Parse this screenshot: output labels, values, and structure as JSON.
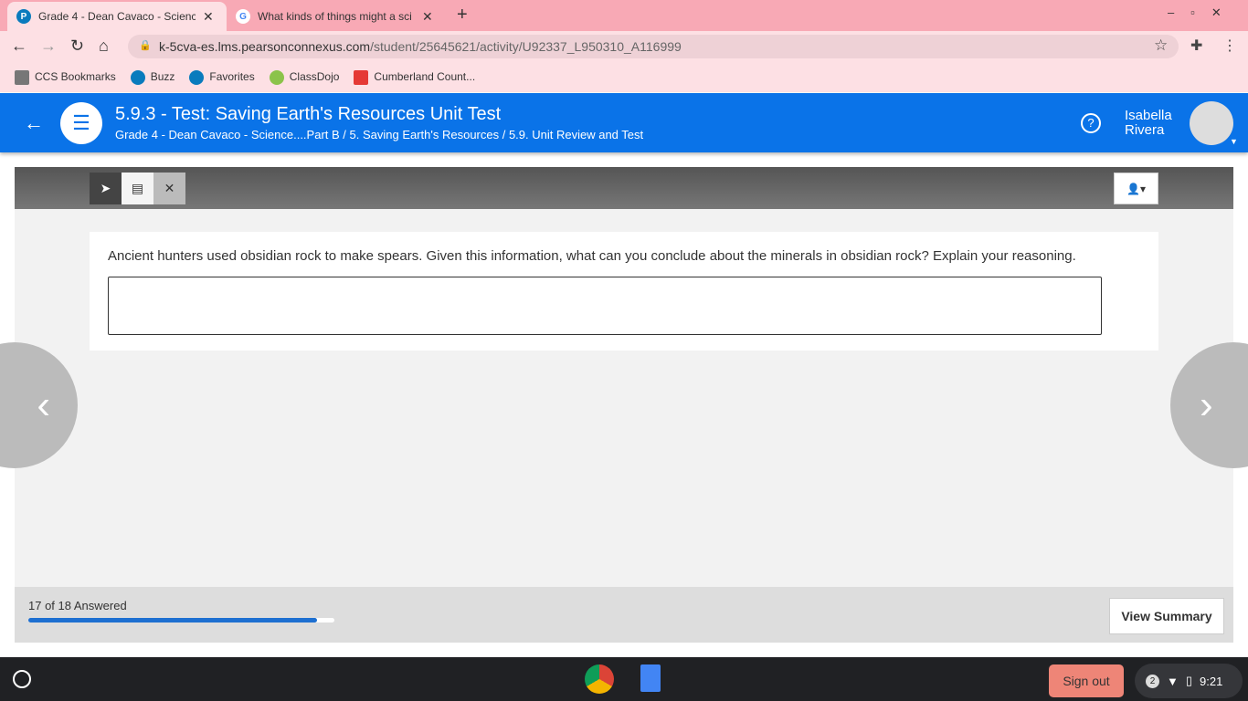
{
  "browser": {
    "tabs": [
      {
        "title": "Grade 4 - Dean Cavaco - Science"
      },
      {
        "title": "What kinds of things might a sci"
      }
    ],
    "url_host": "k-5cva-es.lms.pearsonconnexus.com",
    "url_path": "/student/25645621/activity/U92337_L950310_A116999",
    "bookmarks": [
      "CCS Bookmarks",
      "Buzz",
      "Favorites",
      "ClassDojo",
      "Cumberland Count..."
    ]
  },
  "header": {
    "title": "5.9.3 - Test: Saving Earth's Resources Unit Test",
    "breadcrumb": "Grade 4 - Dean Cavaco - Science....Part B / 5. Saving Earth's Resources / 5.9. Unit Review and Test",
    "user_first": "Isabella",
    "user_last": "Rivera"
  },
  "question": {
    "text": "Ancient hunters used obsidian rock to make spears. Given this information, what can you conclude about the minerals in obsidian rock? Explain your reasoning.",
    "answer": ""
  },
  "footer": {
    "progress_text": "17 of 18 Answered",
    "progress_fraction": 0.944,
    "view_summary": "View Summary"
  },
  "shelf": {
    "sign_out": "Sign out",
    "notifications": "2",
    "time": "9:21"
  }
}
